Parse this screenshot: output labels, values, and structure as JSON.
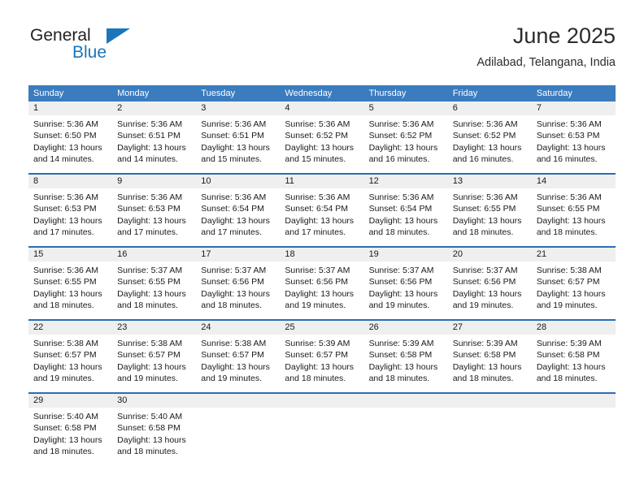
{
  "brand": {
    "name_part1": "General",
    "name_part2": "Blue",
    "triangle_icon": "triangle-icon",
    "color_primary": "#1b75bb",
    "color_text": "#231f20"
  },
  "header": {
    "title": "June 2025",
    "subtitle": "Adilabad, Telangana, India"
  },
  "theme": {
    "header_row_bg": "#3a7cbe",
    "week_divider": "#2a6db3",
    "number_band_bg": "#efefef",
    "text": "#1a1a1a"
  },
  "calendar": {
    "day_headers": [
      "Sunday",
      "Monday",
      "Tuesday",
      "Wednesday",
      "Thursday",
      "Friday",
      "Saturday"
    ],
    "weeks": [
      {
        "days": [
          {
            "date": "1",
            "sunrise": "Sunrise: 5:36 AM",
            "sunset": "Sunset: 6:50 PM",
            "daylight1": "Daylight: 13 hours",
            "daylight2": "and 14 minutes."
          },
          {
            "date": "2",
            "sunrise": "Sunrise: 5:36 AM",
            "sunset": "Sunset: 6:51 PM",
            "daylight1": "Daylight: 13 hours",
            "daylight2": "and 14 minutes."
          },
          {
            "date": "3",
            "sunrise": "Sunrise: 5:36 AM",
            "sunset": "Sunset: 6:51 PM",
            "daylight1": "Daylight: 13 hours",
            "daylight2": "and 15 minutes."
          },
          {
            "date": "4",
            "sunrise": "Sunrise: 5:36 AM",
            "sunset": "Sunset: 6:52 PM",
            "daylight1": "Daylight: 13 hours",
            "daylight2": "and 15 minutes."
          },
          {
            "date": "5",
            "sunrise": "Sunrise: 5:36 AM",
            "sunset": "Sunset: 6:52 PM",
            "daylight1": "Daylight: 13 hours",
            "daylight2": "and 16 minutes."
          },
          {
            "date": "6",
            "sunrise": "Sunrise: 5:36 AM",
            "sunset": "Sunset: 6:52 PM",
            "daylight1": "Daylight: 13 hours",
            "daylight2": "and 16 minutes."
          },
          {
            "date": "7",
            "sunrise": "Sunrise: 5:36 AM",
            "sunset": "Sunset: 6:53 PM",
            "daylight1": "Daylight: 13 hours",
            "daylight2": "and 16 minutes."
          }
        ]
      },
      {
        "days": [
          {
            "date": "8",
            "sunrise": "Sunrise: 5:36 AM",
            "sunset": "Sunset: 6:53 PM",
            "daylight1": "Daylight: 13 hours",
            "daylight2": "and 17 minutes."
          },
          {
            "date": "9",
            "sunrise": "Sunrise: 5:36 AM",
            "sunset": "Sunset: 6:53 PM",
            "daylight1": "Daylight: 13 hours",
            "daylight2": "and 17 minutes."
          },
          {
            "date": "10",
            "sunrise": "Sunrise: 5:36 AM",
            "sunset": "Sunset: 6:54 PM",
            "daylight1": "Daylight: 13 hours",
            "daylight2": "and 17 minutes."
          },
          {
            "date": "11",
            "sunrise": "Sunrise: 5:36 AM",
            "sunset": "Sunset: 6:54 PM",
            "daylight1": "Daylight: 13 hours",
            "daylight2": "and 17 minutes."
          },
          {
            "date": "12",
            "sunrise": "Sunrise: 5:36 AM",
            "sunset": "Sunset: 6:54 PM",
            "daylight1": "Daylight: 13 hours",
            "daylight2": "and 18 minutes."
          },
          {
            "date": "13",
            "sunrise": "Sunrise: 5:36 AM",
            "sunset": "Sunset: 6:55 PM",
            "daylight1": "Daylight: 13 hours",
            "daylight2": "and 18 minutes."
          },
          {
            "date": "14",
            "sunrise": "Sunrise: 5:36 AM",
            "sunset": "Sunset: 6:55 PM",
            "daylight1": "Daylight: 13 hours",
            "daylight2": "and 18 minutes."
          }
        ]
      },
      {
        "days": [
          {
            "date": "15",
            "sunrise": "Sunrise: 5:36 AM",
            "sunset": "Sunset: 6:55 PM",
            "daylight1": "Daylight: 13 hours",
            "daylight2": "and 18 minutes."
          },
          {
            "date": "16",
            "sunrise": "Sunrise: 5:37 AM",
            "sunset": "Sunset: 6:55 PM",
            "daylight1": "Daylight: 13 hours",
            "daylight2": "and 18 minutes."
          },
          {
            "date": "17",
            "sunrise": "Sunrise: 5:37 AM",
            "sunset": "Sunset: 6:56 PM",
            "daylight1": "Daylight: 13 hours",
            "daylight2": "and 18 minutes."
          },
          {
            "date": "18",
            "sunrise": "Sunrise: 5:37 AM",
            "sunset": "Sunset: 6:56 PM",
            "daylight1": "Daylight: 13 hours",
            "daylight2": "and 19 minutes."
          },
          {
            "date": "19",
            "sunrise": "Sunrise: 5:37 AM",
            "sunset": "Sunset: 6:56 PM",
            "daylight1": "Daylight: 13 hours",
            "daylight2": "and 19 minutes."
          },
          {
            "date": "20",
            "sunrise": "Sunrise: 5:37 AM",
            "sunset": "Sunset: 6:56 PM",
            "daylight1": "Daylight: 13 hours",
            "daylight2": "and 19 minutes."
          },
          {
            "date": "21",
            "sunrise": "Sunrise: 5:38 AM",
            "sunset": "Sunset: 6:57 PM",
            "daylight1": "Daylight: 13 hours",
            "daylight2": "and 19 minutes."
          }
        ]
      },
      {
        "days": [
          {
            "date": "22",
            "sunrise": "Sunrise: 5:38 AM",
            "sunset": "Sunset: 6:57 PM",
            "daylight1": "Daylight: 13 hours",
            "daylight2": "and 19 minutes."
          },
          {
            "date": "23",
            "sunrise": "Sunrise: 5:38 AM",
            "sunset": "Sunset: 6:57 PM",
            "daylight1": "Daylight: 13 hours",
            "daylight2": "and 19 minutes."
          },
          {
            "date": "24",
            "sunrise": "Sunrise: 5:38 AM",
            "sunset": "Sunset: 6:57 PM",
            "daylight1": "Daylight: 13 hours",
            "daylight2": "and 19 minutes."
          },
          {
            "date": "25",
            "sunrise": "Sunrise: 5:39 AM",
            "sunset": "Sunset: 6:57 PM",
            "daylight1": "Daylight: 13 hours",
            "daylight2": "and 18 minutes."
          },
          {
            "date": "26",
            "sunrise": "Sunrise: 5:39 AM",
            "sunset": "Sunset: 6:58 PM",
            "daylight1": "Daylight: 13 hours",
            "daylight2": "and 18 minutes."
          },
          {
            "date": "27",
            "sunrise": "Sunrise: 5:39 AM",
            "sunset": "Sunset: 6:58 PM",
            "daylight1": "Daylight: 13 hours",
            "daylight2": "and 18 minutes."
          },
          {
            "date": "28",
            "sunrise": "Sunrise: 5:39 AM",
            "sunset": "Sunset: 6:58 PM",
            "daylight1": "Daylight: 13 hours",
            "daylight2": "and 18 minutes."
          }
        ]
      },
      {
        "days": [
          {
            "date": "29",
            "sunrise": "Sunrise: 5:40 AM",
            "sunset": "Sunset: 6:58 PM",
            "daylight1": "Daylight: 13 hours",
            "daylight2": "and 18 minutes."
          },
          {
            "date": "30",
            "sunrise": "Sunrise: 5:40 AM",
            "sunset": "Sunset: 6:58 PM",
            "daylight1": "Daylight: 13 hours",
            "daylight2": "and 18 minutes."
          },
          {
            "date": "",
            "sunrise": "",
            "sunset": "",
            "daylight1": "",
            "daylight2": ""
          },
          {
            "date": "",
            "sunrise": "",
            "sunset": "",
            "daylight1": "",
            "daylight2": ""
          },
          {
            "date": "",
            "sunrise": "",
            "sunset": "",
            "daylight1": "",
            "daylight2": ""
          },
          {
            "date": "",
            "sunrise": "",
            "sunset": "",
            "daylight1": "",
            "daylight2": ""
          },
          {
            "date": "",
            "sunrise": "",
            "sunset": "",
            "daylight1": "",
            "daylight2": ""
          }
        ]
      }
    ]
  }
}
